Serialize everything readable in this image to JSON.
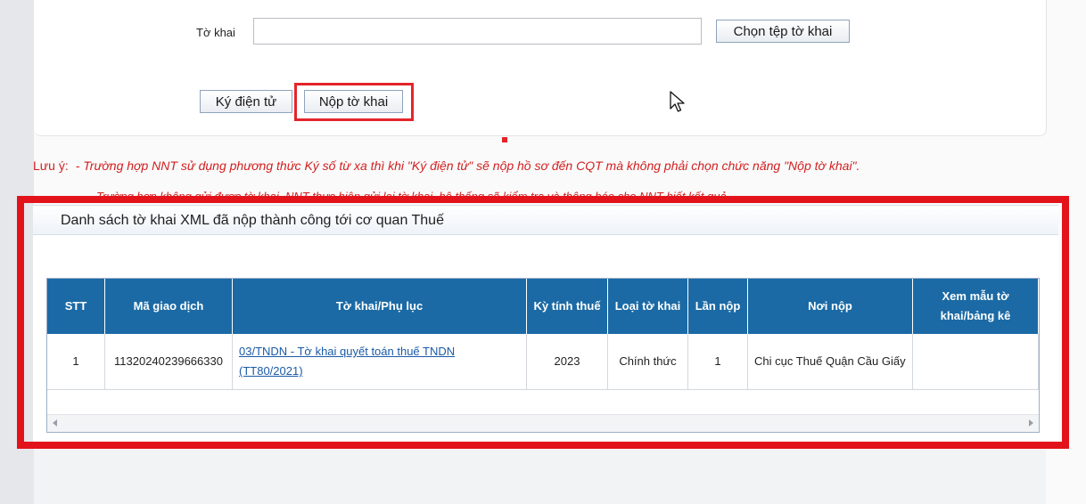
{
  "form": {
    "tokhai_label": "Tờ khai",
    "tokhai_value": "",
    "choose_file_label": "Chọn tệp tờ khai",
    "sign_label": "Ký điện tử",
    "submit_label": "Nộp tờ khai"
  },
  "note": {
    "label": "Lưu ý:",
    "line1": "- Trường hợp NNT sử dụng phương thức Ký số từ xa thì khi \"Ký điện tử\" sẽ nộp hồ sơ đến CQT mà không phải chọn chức năng \"Nộp tờ khai\".",
    "line2": "- Trường hợp không gửi được tờ khai, NNT thực hiện gửi lại tờ khai, hệ thống sẽ kiểm tra và thông báo cho NNT biết kết quả."
  },
  "list": {
    "title": "Danh sách tờ khai XML đã nộp thành công tới cơ quan Thuế",
    "columns": [
      "STT",
      "Mã giao dịch",
      "Tờ khai/Phụ lục",
      "Kỳ tính thuế",
      "Loại tờ khai",
      "Lần nộp",
      "Nơi nộp",
      "Xem mẫu tờ khai/bảng kê"
    ],
    "rows": [
      {
        "stt": "1",
        "ma_giao_dich": "11320240239666330",
        "to_khai": "03/TNDN - Tờ khai quyết toán thuế TNDN (TT80/2021)",
        "ky_tinh_thue": "2023",
        "loai_to_khai": "Chính thức",
        "lan_nop": "1",
        "noi_nop": "Chi cục Thuế Quận Cầu Giấy",
        "xem_mau": ""
      }
    ]
  },
  "colors": {
    "accent_red": "#e3131b",
    "table_header": "#1b6aa5",
    "link": "#1b5aa6",
    "note_red": "#d21f1f"
  },
  "icons": {
    "cursor": "mouse-pointer-icon",
    "scroll_left": "arrow-left-icon",
    "scroll_right": "arrow-right-icon"
  }
}
